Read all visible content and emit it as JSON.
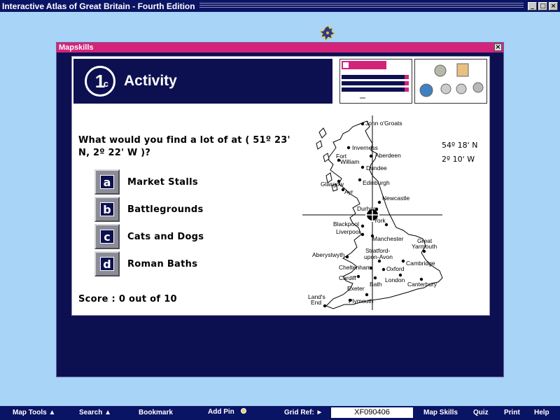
{
  "app": {
    "title": "Interactive Atlas of Great Britain - Fourth Edition",
    "controls": {
      "minimize": "_",
      "maximize": "□",
      "close": "×"
    }
  },
  "window": {
    "title": "Mapskills",
    "close": "×"
  },
  "activity": {
    "badge_number": "1",
    "badge_letter": "c",
    "title": "Activity"
  },
  "question": "What would you find a lot of at ( 51º 23' N, 2º 22' W )?",
  "answers": [
    {
      "key": "a",
      "label": "Market Stalls"
    },
    {
      "key": "b",
      "label": "Battlegrounds"
    },
    {
      "key": "c",
      "label": "Cats and Dogs"
    },
    {
      "key": "d",
      "label": "Roman Baths"
    }
  ],
  "score": "Score : 0 out of 10",
  "coordinates": {
    "lat": "54º 18' N",
    "lon": "2º 10' W"
  },
  "map_labels": [
    "John o'Groats",
    "Inverness",
    "Aberdeen",
    "Fort William",
    "Dundee",
    "Glasgow",
    "Edinburgh",
    "Ayr",
    "Newcastle",
    "Durham",
    "York",
    "Blackpool",
    "Liverpool",
    "Manchester",
    "Great Yarmouth",
    "Aberystwyth",
    "Stratford-",
    "upon-Avon",
    "Cambridge",
    "Cheltenham",
    "Oxford",
    "Cardiff",
    "London",
    "Bath",
    "Canterbury",
    "Exeter",
    "Land's",
    "End",
    "Plymouth"
  ],
  "toolbar": {
    "map_tools": "Map Tools ▲",
    "search": "Search ▲",
    "bookmark": "Bookmark",
    "add_pin": "Add Pin",
    "grid_ref_label": "Grid Ref: ►",
    "grid_ref_value": "XF090406",
    "map_skills": "Map Skills",
    "quiz": "Quiz",
    "print": "Print",
    "help": "Help"
  },
  "colors": {
    "navy": "#0d1050",
    "pink": "#d4237a",
    "sky": "#a8d4f8"
  }
}
